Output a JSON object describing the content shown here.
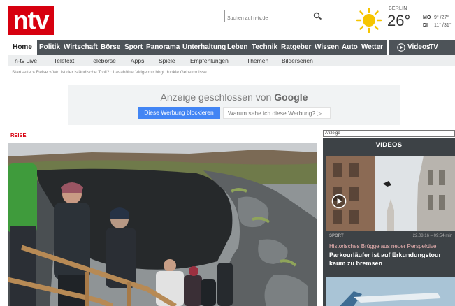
{
  "logo": {
    "text": "ntv"
  },
  "search": {
    "placeholder": "Suchen auf n-tv.de"
  },
  "weather": {
    "city": "BERLIN",
    "temp": "26°",
    "days": [
      {
        "day": "MO",
        "temps": "9° /27°"
      },
      {
        "day": "DI",
        "temps": "11° /31°"
      }
    ]
  },
  "nav_main": [
    {
      "label": "Home",
      "active": true
    },
    {
      "label": "Politik"
    },
    {
      "label": "Wirtschaft"
    },
    {
      "label": "Börse"
    },
    {
      "label": "Sport"
    },
    {
      "label": "Panorama"
    },
    {
      "label": "Unterhaltung"
    },
    {
      "label": "Leben"
    },
    {
      "label": "Technik"
    },
    {
      "label": "Ratgeber"
    },
    {
      "label": "Wissen"
    },
    {
      "label": "Auto"
    },
    {
      "label": "Wetter"
    },
    {
      "label": "Videos"
    },
    {
      "label": "TV"
    }
  ],
  "nav_sub": [
    "n-tv Live",
    "Teletext",
    "Telebörse",
    "Apps",
    "Spiele",
    "Empfehlungen",
    "Themen",
    "Bilderserien"
  ],
  "breadcrumb": "Startseite » Reise » Wo ist der isländische Troll? : Lavahöhle Vidgelmir birgt dunkle Geheimnisse",
  "ad": {
    "title_prefix": "Anzeige geschlossen von",
    "title_brand": "Google",
    "block_button": "Diese Werbung blockieren",
    "why_button": "Warum sehe ich diese Werbung? ▷"
  },
  "section": "REISE",
  "sidebar": {
    "anzeige": "Anzeige",
    "videos_title": "VIDEOS",
    "video": {
      "category": "SPORT",
      "time": "22.08.16 – 09:54 min",
      "kicker": "Historisches Brügge aus neuer Perspektive",
      "headline": "Parkourläufer ist auf Erkundungstour kaum zu bremsen"
    }
  },
  "colors": {
    "brand": "#d7000f",
    "nav": "#4d5358",
    "google_blue": "#4285f4"
  }
}
